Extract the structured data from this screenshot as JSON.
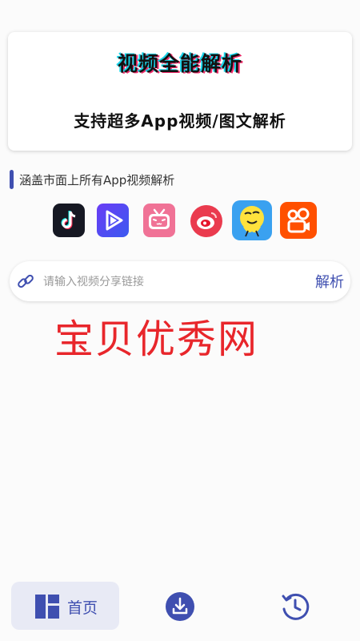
{
  "banner": {
    "title": "视频全能解析",
    "subtitle": "支持超多App视频/图文解析"
  },
  "section": {
    "label": "涵盖市面上所有App视频解析"
  },
  "platforms": [
    {
      "icon": "tiktok-icon",
      "color": "#161823"
    },
    {
      "icon": "play-icon",
      "color": "#5a3df0"
    },
    {
      "icon": "bilibili-icon",
      "color": "#f07296"
    },
    {
      "icon": "weibo-icon",
      "color": "#e6162d"
    },
    {
      "icon": "pipixia-icon",
      "color": "#3aa1f0"
    },
    {
      "icon": "kuaishou-icon",
      "color": "#ff5000"
    }
  ],
  "link_input": {
    "placeholder": "请输入视频分享链接",
    "value": "",
    "parse_label": "解析"
  },
  "watermark": "宝贝优秀网",
  "tabbar": {
    "home_label": "首页",
    "accent": "#3f4fb0"
  }
}
